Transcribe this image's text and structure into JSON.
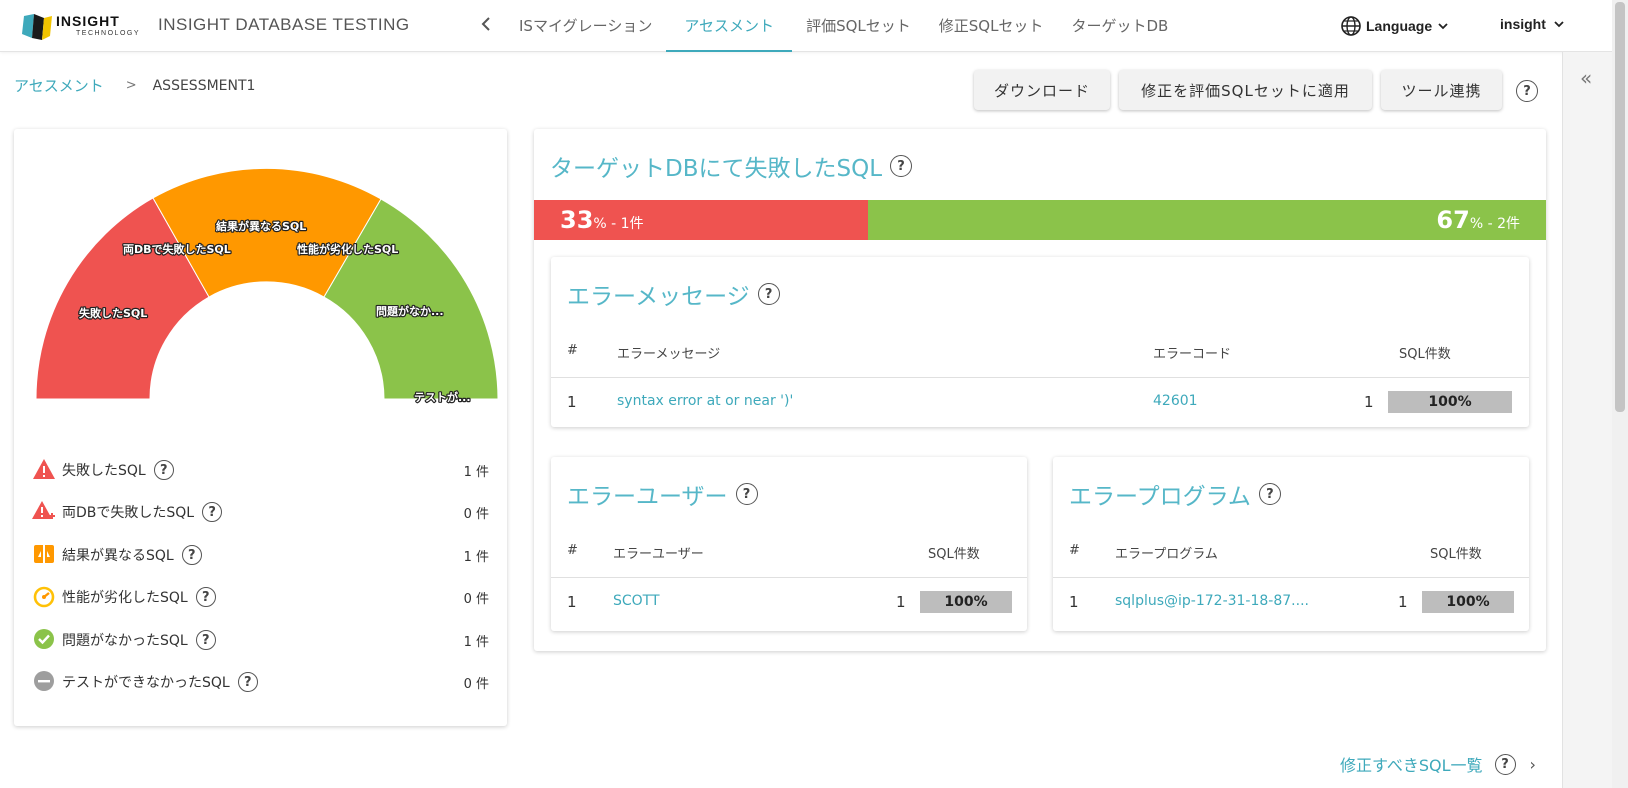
{
  "header": {
    "logo_text": "INSIGHT",
    "logo_sub": "TECHNOLOGY",
    "app_title": "INSIGHT DATABASE TESTING",
    "tabs": [
      {
        "label": "ISマイグレーション",
        "active": false
      },
      {
        "label": "アセスメント",
        "active": true
      },
      {
        "label": "評価SQLセット",
        "active": false
      },
      {
        "label": "修正SQLセット",
        "active": false
      },
      {
        "label": "ターゲットDB",
        "active": false
      }
    ],
    "language_label": "Language",
    "user_label": "insight",
    "accent_color": "#3ea9bb"
  },
  "breadcrumb": {
    "parent": "アセスメント",
    "separator": ">",
    "current": "ASSESSMENT1"
  },
  "toolbar": {
    "download_label": "ダウンロード",
    "apply_label": "修正を評価SQLセットに適用",
    "tool_label": "ツール連携",
    "help": "?"
  },
  "gauge": {
    "segments": [
      {
        "label": "失敗したSQL",
        "value": 1,
        "color": "#ef5350"
      },
      {
        "label": "両DBで失敗したSQL",
        "value": 0,
        "color": "#ef5350"
      },
      {
        "label": "結果が異なるSQL",
        "value": 1,
        "color": "#ff9800"
      },
      {
        "label": "性能が劣化したSQL",
        "value": 0,
        "color": "#ff9800"
      },
      {
        "label": "問題がなか...",
        "value": 1,
        "color": "#8bc34a"
      },
      {
        "label": "テストが...",
        "value": 0,
        "color": "#9e9e9e"
      }
    ]
  },
  "legend": [
    {
      "label": "失敗したSQL",
      "count": "1 件",
      "icon": "warning-icon",
      "color": "#ef5350"
    },
    {
      "label": "両DBで失敗したSQL",
      "count": "0 件",
      "icon": "warning-plus-icon",
      "color": "#ef5350"
    },
    {
      "label": "結果が異なるSQL",
      "count": "1 件",
      "icon": "compare-icon",
      "color": "#ff9800"
    },
    {
      "label": "性能が劣化したSQL",
      "count": "0 件",
      "icon": "speedometer-icon",
      "color": "#ffc107"
    },
    {
      "label": "問題がなかったSQL",
      "count": "1 件",
      "icon": "check-circle-icon",
      "color": "#8bc34a"
    },
    {
      "label": "テストができなかったSQL",
      "count": "0 件",
      "icon": "minus-circle-icon",
      "color": "#9e9e9e"
    }
  ],
  "failed_panel": {
    "title": "ターゲットDBにて失敗したSQL",
    "fail": {
      "percent": "33",
      "suffix": "% - 1件",
      "fraction": 0.33,
      "color": "#ef5350"
    },
    "ok": {
      "percent": "67",
      "suffix": "% - 2件",
      "fraction": 0.67,
      "color": "#8bc34a"
    }
  },
  "error_messages": {
    "title": "エラーメッセージ",
    "headers": [
      "#",
      "エラーメッセージ",
      "エラーコード",
      "SQL件数"
    ],
    "rows": [
      {
        "no": "1",
        "message": "syntax error at or near ')'",
        "code": "42601",
        "count": "1",
        "percent": "100%"
      }
    ]
  },
  "error_users": {
    "title": "エラーユーザー",
    "headers": [
      "#",
      "エラーユーザー",
      "SQL件数"
    ],
    "rows": [
      {
        "no": "1",
        "user": "SCOTT",
        "count": "1",
        "percent": "100%"
      }
    ]
  },
  "error_programs": {
    "title": "エラープログラム",
    "headers": [
      "#",
      "エラープログラム",
      "SQL件数"
    ],
    "rows": [
      {
        "no": "1",
        "program": "sqlplus@ip-172-31-18-87....",
        "count": "1",
        "percent": "100%"
      }
    ]
  },
  "footer": {
    "link_label": "修正すべきSQL一覧",
    "chevron": "›"
  }
}
